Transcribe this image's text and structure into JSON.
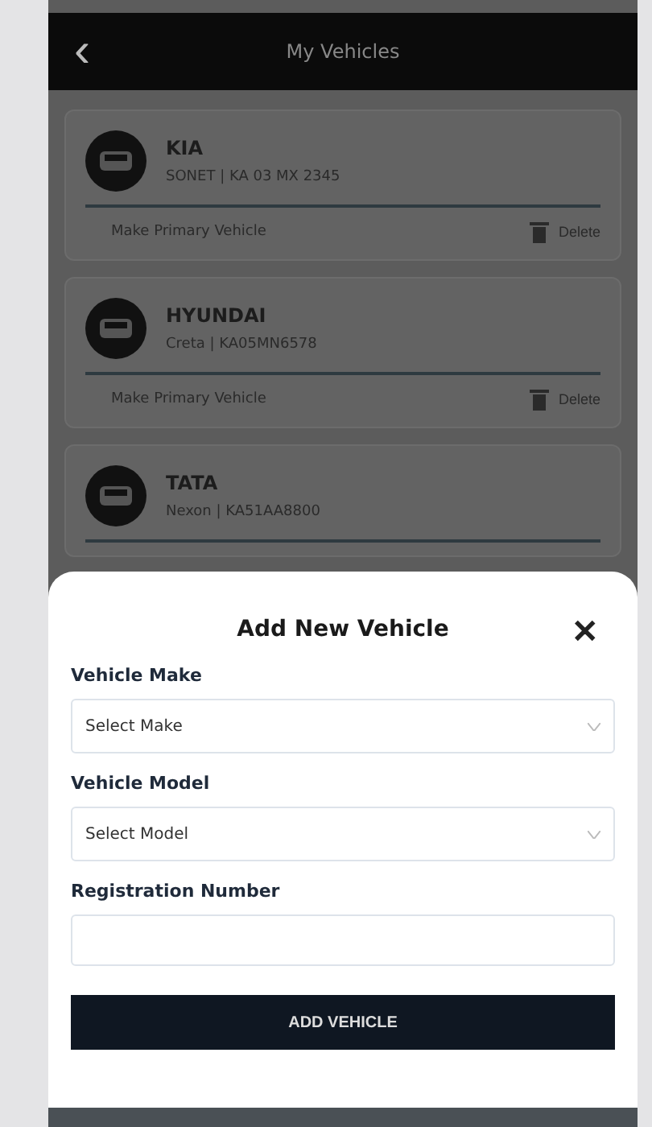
{
  "header": {
    "back": "‹",
    "title": "My Vehicles"
  },
  "vehicles": [
    {
      "make": "KIA",
      "details": "SONET | KA 03 MX 2345",
      "primary_label": "Make Primary Vehicle",
      "delete_label": "Delete"
    },
    {
      "make": "HYUNDAI",
      "details": "Creta | KA05MN6578",
      "primary_label": "Make Primary Vehicle",
      "delete_label": "Delete"
    },
    {
      "make": "TATA",
      "details": "Nexon | KA51AA8800"
    }
  ],
  "sheet": {
    "title": "Add New Vehicle",
    "close": "✕",
    "fields": [
      {
        "label": "Vehicle Make",
        "kind": "select",
        "placeholder": "Select Make"
      },
      {
        "label": "Vehicle Model",
        "kind": "select",
        "placeholder": "Select Model"
      },
      {
        "label": "Registration Number",
        "kind": "text"
      }
    ],
    "button": "ADD VEHICLE"
  }
}
